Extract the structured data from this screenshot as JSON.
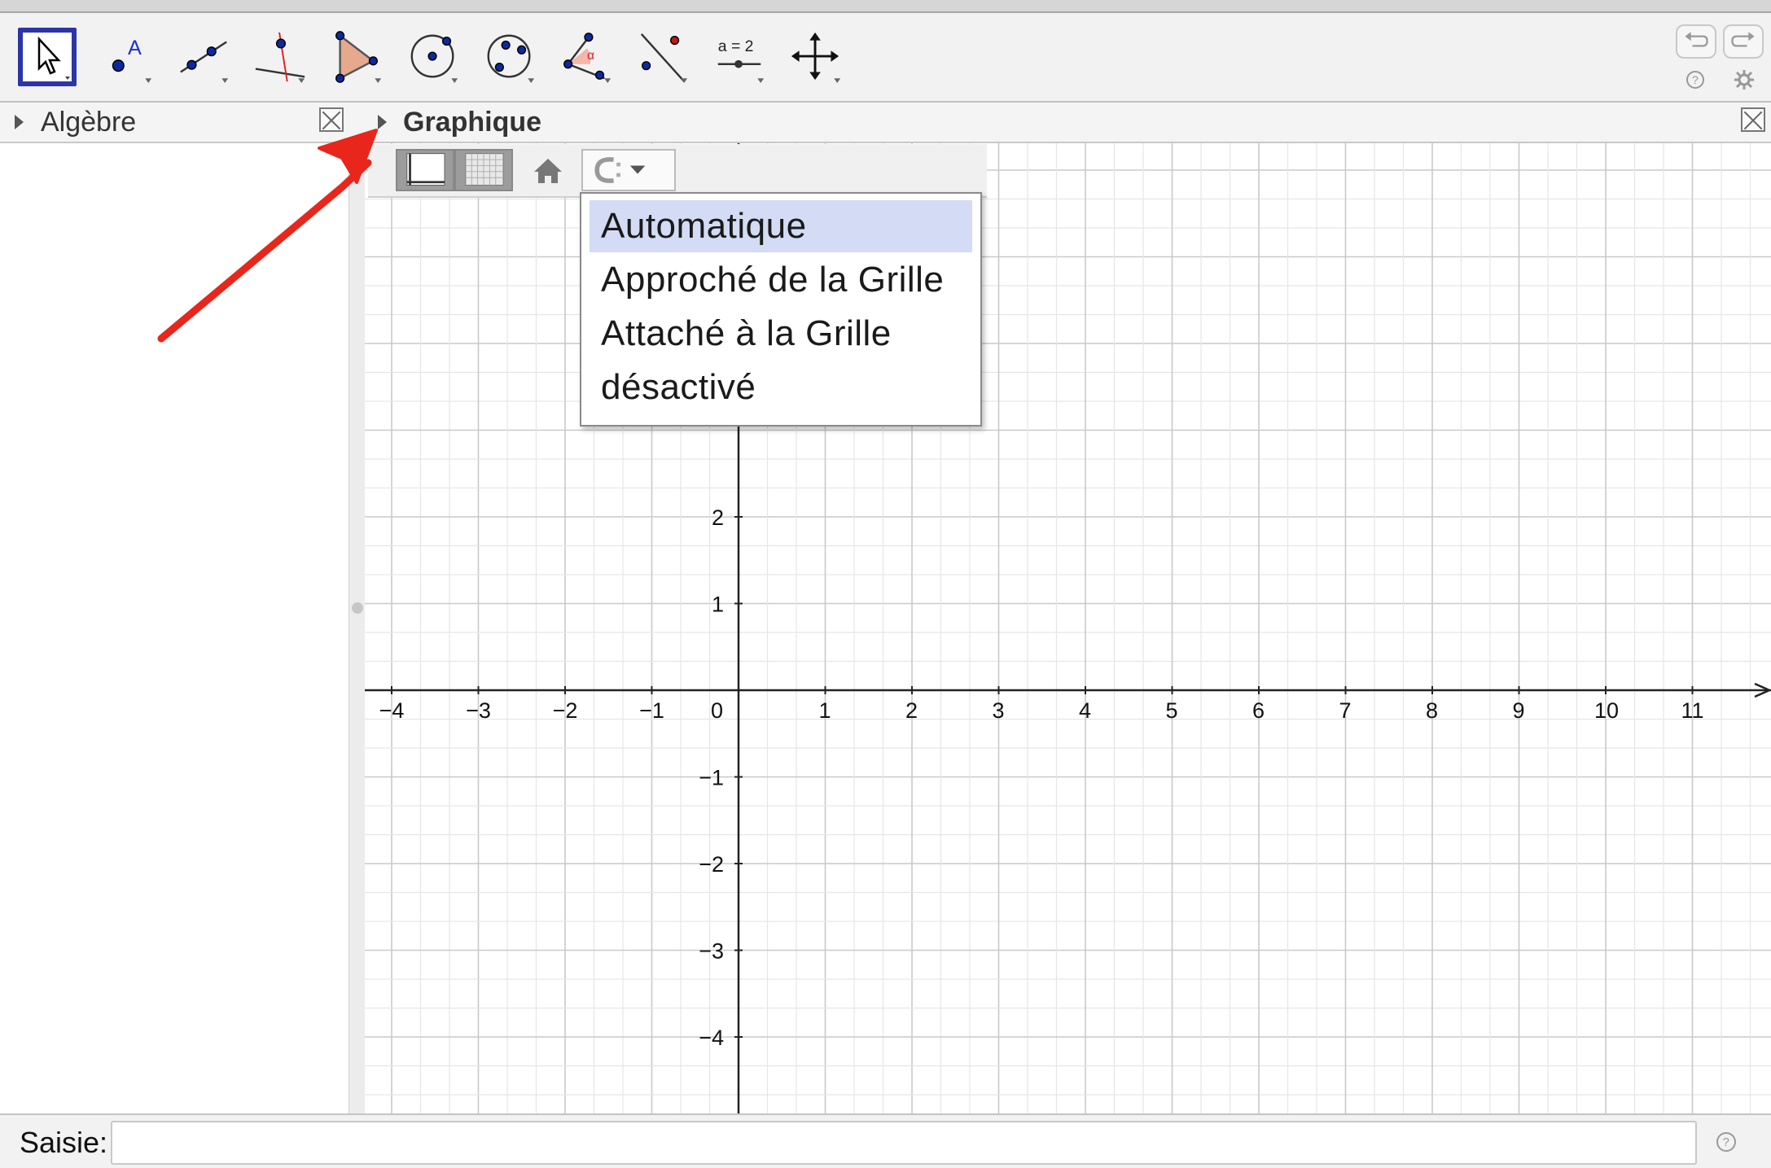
{
  "toolbar": {
    "tools": [
      {
        "name": "move-tool",
        "icon": "arrow-cursor-icon"
      },
      {
        "name": "point-tool",
        "icon": "point-A-icon",
        "letter": "A"
      },
      {
        "name": "line-tool",
        "icon": "line-through-points-icon"
      },
      {
        "name": "perpendicular-tool",
        "icon": "perpendicular-line-icon"
      },
      {
        "name": "polygon-tool",
        "icon": "polygon-icon"
      },
      {
        "name": "circle-center-tool",
        "icon": "circle-center-point-icon"
      },
      {
        "name": "circle-three-points-tool",
        "icon": "circle-three-points-icon"
      },
      {
        "name": "angle-tool",
        "icon": "angle-icon",
        "letter": "α"
      },
      {
        "name": "reflect-tool",
        "icon": "reflect-about-line-icon"
      },
      {
        "name": "slider-tool",
        "icon": "slider-icon",
        "label": "a = 2"
      },
      {
        "name": "move-graphics-tool",
        "icon": "move-arrows-icon"
      }
    ]
  },
  "panels": {
    "algebra_title": "Algèbre",
    "graphics_title": "Graphique"
  },
  "point_capture_menu": {
    "items": [
      "Automatique",
      "Approché de la Grille",
      "Attaché à la Grille",
      "désactivé"
    ],
    "selected": "Automatique"
  },
  "axes": {
    "x_ticks": [
      "−4",
      "−3",
      "−2",
      "−1",
      "0",
      "1",
      "2",
      "3",
      "4",
      "5",
      "6",
      "7",
      "8",
      "9",
      "10",
      "11"
    ],
    "y_ticks": [
      "2",
      "1",
      "−1",
      "−2",
      "−3",
      "−4"
    ]
  },
  "input_bar": {
    "label": "Saisie:",
    "value": ""
  },
  "colors": {
    "active_tool_border": "#2b35a8",
    "menu_highlight": "#d3dcf4",
    "annotation_arrow": "#e8261c"
  }
}
